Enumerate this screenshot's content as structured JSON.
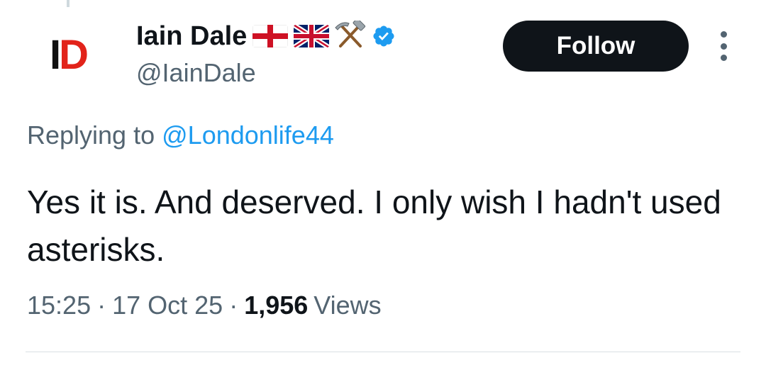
{
  "author": {
    "display_name": "Iain Dale",
    "handle": "@IainDale",
    "avatar_text_1": "I",
    "avatar_text_2": "D",
    "name_emojis": [
      "england-flag-icon",
      "uk-flag-icon",
      "hammer-and-pick-icon"
    ],
    "verified": true
  },
  "actions": {
    "follow_label": "Follow"
  },
  "reply": {
    "prefix": "Replying to",
    "mention": "@Londonlife44"
  },
  "tweet": {
    "text": "Yes it is. And deserved. I only wish I hadn't used asterisks.",
    "time": "15:25",
    "separator": "·",
    "date": "17 Oct 25",
    "views_count": "1,956",
    "views_label": "Views"
  },
  "colors": {
    "accent": "#1d9bf0",
    "text_primary": "#0f1419",
    "text_secondary": "#536471",
    "button_bg": "#0f1419",
    "avatar_red": "#e2231a"
  }
}
